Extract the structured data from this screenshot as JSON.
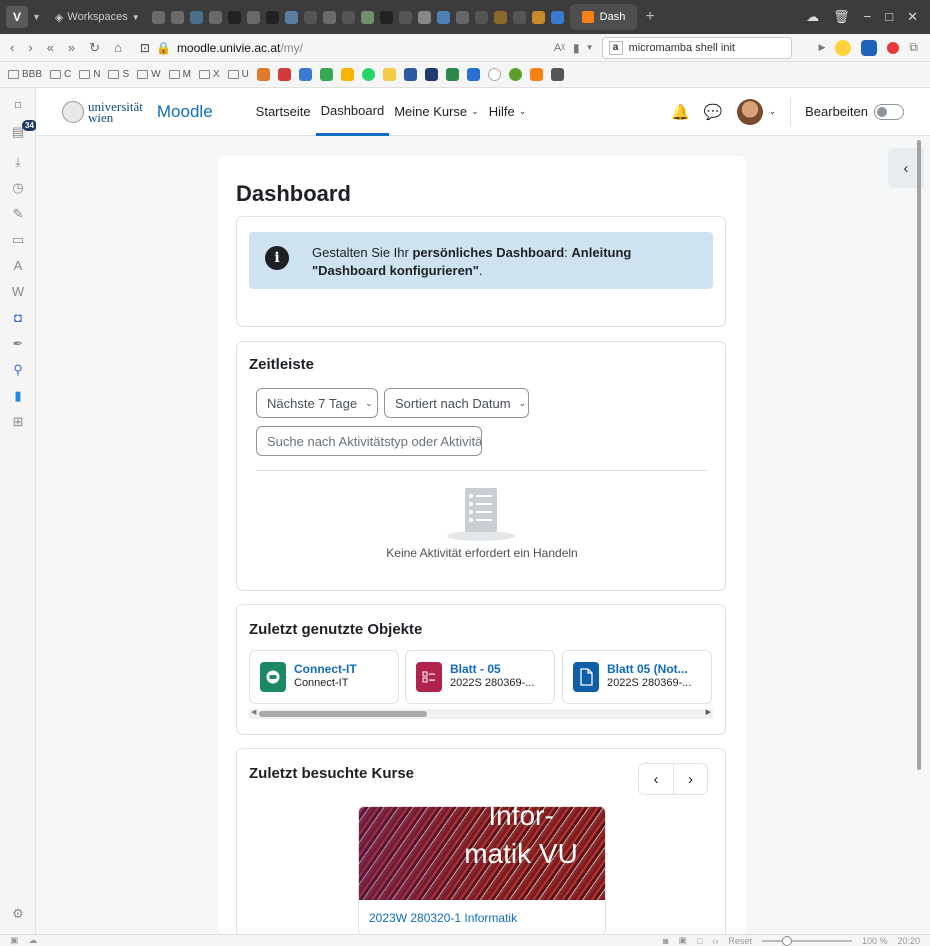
{
  "browser": {
    "workspaces_label": "Workspaces",
    "active_tab_label": "Dash",
    "url_domain": "moodle.univie.ac.at",
    "url_path": "/my/",
    "search_text": "micromamba shell init",
    "bookmarks": [
      "BBB",
      "C",
      "N",
      "S",
      "W",
      "M",
      "X",
      "U"
    ],
    "sidebar_badge": "34",
    "status_reset": "Reset",
    "status_zoom": "100 %",
    "status_time": "20:20"
  },
  "moodle": {
    "logo_line1": "universität",
    "logo_line2": "wien",
    "brand": "Moodle",
    "nav": {
      "home": "Startseite",
      "dashboard": "Dashboard",
      "my_courses": "Meine Kurse",
      "help": "Hilfe"
    },
    "edit_mode_label": "Bearbeiten"
  },
  "page": {
    "title": "Dashboard",
    "alert": {
      "prefix": "Gestalten Sie Ihr ",
      "bold1": "persönliches Dashboard",
      "sep": ": ",
      "link": "Anleitung \"Dashboard konfigurieren\"",
      "suffix": "."
    },
    "timeline": {
      "title": "Zeitleiste",
      "filter_label": "Nächste 7 Tage",
      "sort_label": "Sortiert nach Datum",
      "search_placeholder": "Suche nach Aktivitätstyp oder Aktivität",
      "empty_text": "Keine Aktivität erfordert ein Handeln"
    },
    "recent_items": {
      "title": "Zuletzt genutzte Objekte",
      "items": [
        {
          "title": "Connect-IT",
          "subtitle": "Connect-IT",
          "color": "#1b8a62",
          "icon": "chat-icon"
        },
        {
          "title": "Blatt - 05",
          "subtitle": "2022S 280369-...",
          "color": "#b0234c",
          "icon": "checklist-icon"
        },
        {
          "title": "Blatt 05 (Not...",
          "subtitle": "2022S 280369-...",
          "color": "#0f5ea8",
          "icon": "file-icon"
        }
      ]
    },
    "recent_courses": {
      "title": "Zuletzt besuchte Kurse",
      "course_image_text": "Infor-matik VU",
      "course_name": "2023W 280320-1 Informatik"
    }
  }
}
